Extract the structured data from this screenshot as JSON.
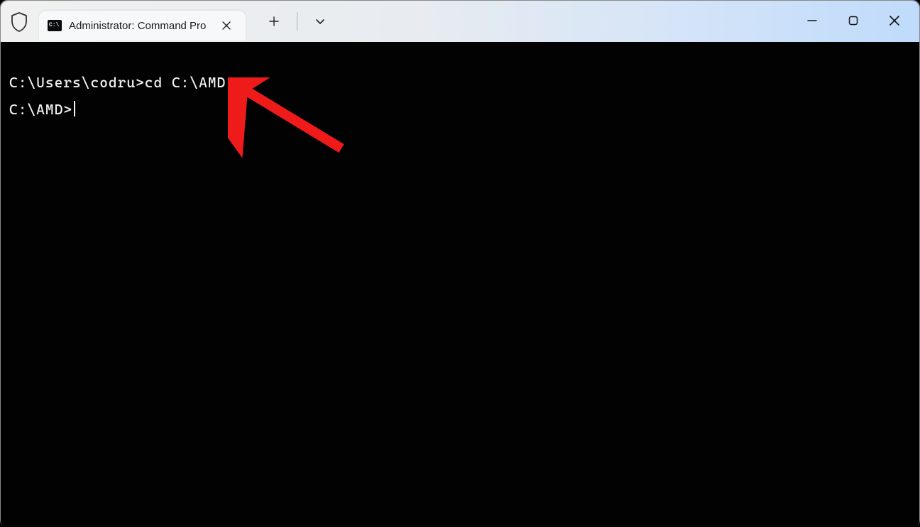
{
  "tab": {
    "title": "Administrator: Command Pro",
    "icon_name": "cmd-icon"
  },
  "terminal": {
    "lines": [
      "C:\\Users\\codru>cd C:\\AMD",
      "",
      "C:\\AMD>"
    ]
  },
  "annotation": {
    "arrow_color": "#ef1a1a"
  }
}
